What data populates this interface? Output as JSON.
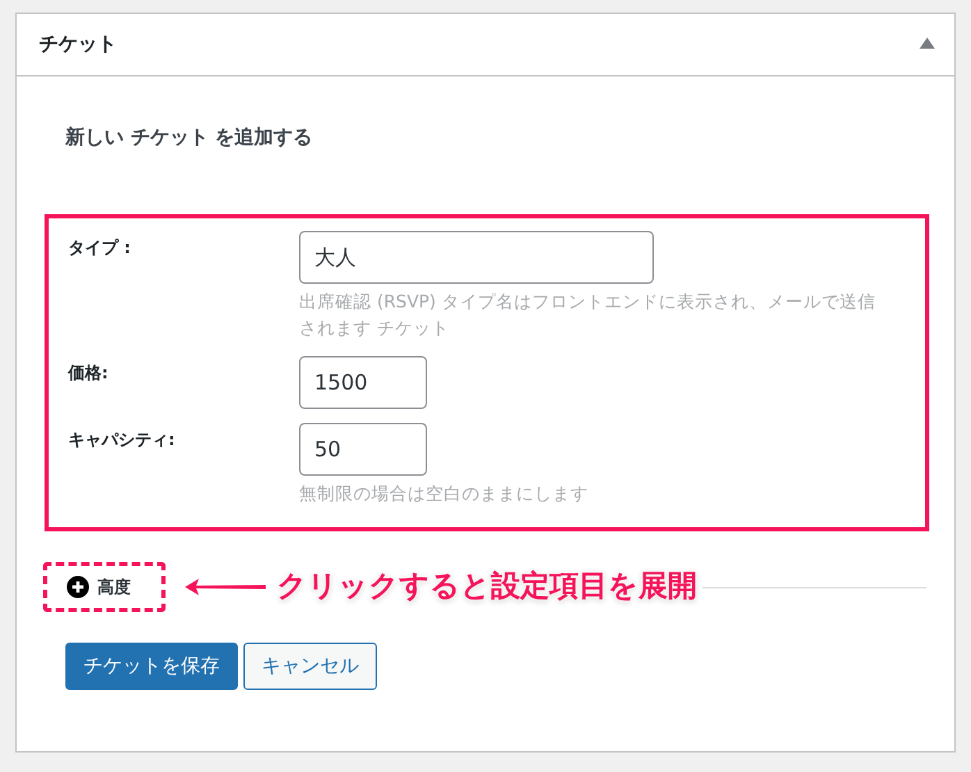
{
  "panel": {
    "title": "チケット",
    "expanded": true
  },
  "heading": "新しい チケット を追加する",
  "fields": [
    {
      "label": "タイプ :",
      "value": "大人",
      "kind": "wide",
      "help": "出席確認 (RSVP) タイプ名はフロントエンドに表示され、メールで送信されます チケット"
    },
    {
      "label": "価格:",
      "value": "1500",
      "kind": "short"
    },
    {
      "label": "キャパシティ:",
      "value": "50",
      "kind": "short",
      "help": "無制限の場合は空白のままにします"
    }
  ],
  "advanced": {
    "label": "高度",
    "expanded": false
  },
  "callout": "クリックすると設定項目を展開",
  "buttons": [
    {
      "label": "チケットを保存",
      "kind": "primary"
    },
    {
      "label": "キャンセル",
      "kind": "secondary"
    }
  ]
}
